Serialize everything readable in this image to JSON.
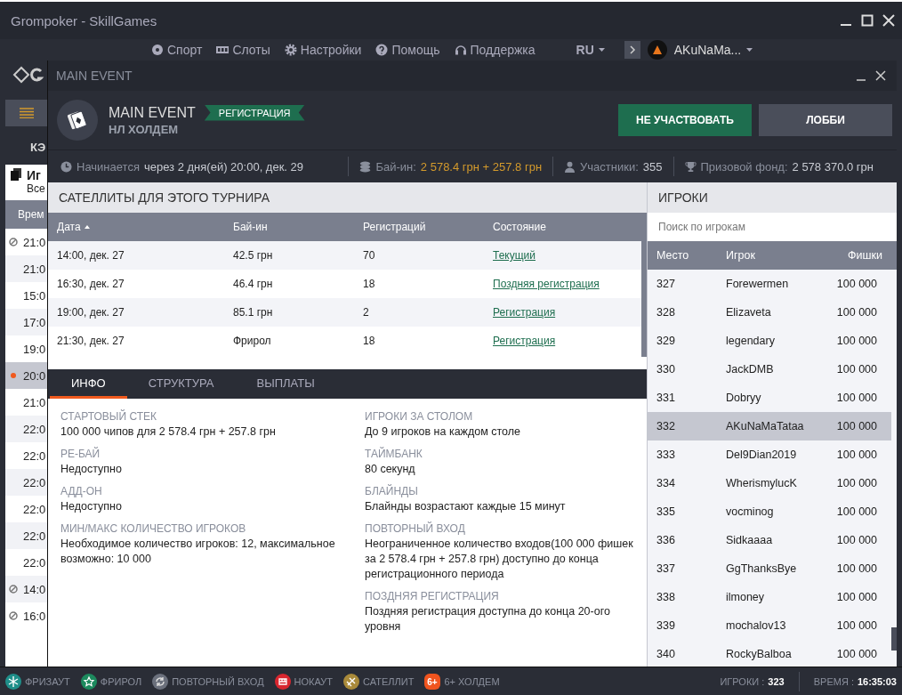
{
  "window": {
    "title": "Grompoker - SkillGames"
  },
  "nav": {
    "items": [
      {
        "label": "Спорт",
        "kind": "ball"
      },
      {
        "label": "Слоты",
        "kind": "slots"
      },
      {
        "label": "Настройки",
        "kind": "gear"
      },
      {
        "label": "Помощь",
        "kind": "help"
      },
      {
        "label": "Поддержка",
        "kind": "headset"
      }
    ],
    "language": "RU",
    "user": "AKuNaMa..."
  },
  "background_list": {
    "heading": "КЭ",
    "title": "Иг",
    "subtitle": "Все",
    "column": "Врем",
    "rows": [
      {
        "time": "21:0",
        "kind": "blocked",
        "selected": false
      },
      {
        "time": "21:0",
        "kind": "plain",
        "selected": false
      },
      {
        "time": "15:0",
        "kind": "plain",
        "selected": false
      },
      {
        "time": "17:0",
        "kind": "plain",
        "selected": false
      },
      {
        "time": "19:0",
        "kind": "plain",
        "selected": false
      },
      {
        "time": "20:0",
        "kind": "live",
        "selected": true
      },
      {
        "time": "21:0",
        "kind": "plain",
        "selected": false
      },
      {
        "time": "22:0",
        "kind": "plain",
        "selected": false
      },
      {
        "time": "22:0",
        "kind": "plain",
        "selected": false
      },
      {
        "time": "22:0",
        "kind": "plain",
        "selected": false
      },
      {
        "time": "22:0",
        "kind": "plain",
        "selected": false
      },
      {
        "time": "22:0",
        "kind": "plain",
        "selected": false
      },
      {
        "time": "22:0",
        "kind": "plain",
        "selected": false
      },
      {
        "time": "14:0",
        "kind": "blocked",
        "selected": false
      },
      {
        "time": "16:0",
        "kind": "blocked",
        "selected": false
      }
    ]
  },
  "dialog": {
    "title": "MAIN EVENT",
    "name": "MAIN EVENT",
    "game": "НЛ ХОЛДЕМ",
    "status": "РЕГИСТРАЦИЯ",
    "buttons": [
      {
        "label": "НЕ УЧАСТВОВАТЬ",
        "kind": "primary"
      },
      {
        "label": "ЛОББИ",
        "kind": "secondary"
      }
    ],
    "info_bar": [
      {
        "label": "Начинается",
        "value": "через 2 дня(ей) 20:00, дек. 29",
        "kind": "plain"
      },
      {
        "label": "Бай-ин:",
        "value": "2 578.4 грн + 257.8 грн",
        "kind": "accent"
      },
      {
        "label": "Участники:",
        "value": "355",
        "kind": "plain"
      },
      {
        "label": "Призовой фонд:",
        "value": "2 578 370.0 грн",
        "kind": "plain"
      }
    ]
  },
  "satellites": {
    "title": "САТЕЛЛИТЫ ДЛЯ ЭТОГО ТУРНИРА",
    "columns": [
      "Дата",
      "Бай-ин",
      "Регистраций",
      "Состояние"
    ],
    "rows": [
      [
        "14:00, дек. 27",
        "42.5 грн",
        "70",
        "Текущий"
      ],
      [
        "16:30, дек. 27",
        "46.4 грн",
        "18",
        "Поздняя регистрация"
      ],
      [
        "19:00, дек. 27",
        "85.1 грн",
        "2",
        "Регистрация"
      ],
      [
        "21:30, дек. 27",
        "Фрирол",
        "18",
        "Регистрация"
      ]
    ]
  },
  "tabs": [
    {
      "label": "ИНФО",
      "selected": true
    },
    {
      "label": "СТРУКТУРА",
      "selected": false
    },
    {
      "label": "ВЫПЛАТЫ",
      "selected": false
    }
  ],
  "info": {
    "left": [
      {
        "label": "СТАРТОВЫЙ СТЕК",
        "value": "100 000 чипов для 2 578.4 грн + 257.8 грн"
      },
      {
        "label": "РЕ-БАЙ",
        "value": "Недоступно"
      },
      {
        "label": "АДД-ОН",
        "value": "Недоступно"
      },
      {
        "label": "МИН/МАКС КОЛИЧЕСТВО ИГРОКОВ",
        "value": "Необходимое количество игроков: 12, максимальное возможно: 10 000"
      }
    ],
    "right": [
      {
        "label": "ИГРОКИ ЗА СТОЛОМ",
        "value": "До 9 игроков на каждом столе"
      },
      {
        "label": "ТАЙМБАНК",
        "value": "80 секунд"
      },
      {
        "label": "БЛАЙНДЫ",
        "value": "Блайнды возрастают каждые 15 минут"
      },
      {
        "label": "ПОВТОРНЫЙ ВХОД",
        "value": "Неограниченное количество входов(100 000 фишек за 2 578.4 грн + 257.8 грн) доступно до конца регистрационного периода"
      },
      {
        "label": "ПОЗДНЯЯ РЕГИСТРАЦИЯ",
        "value": "Поздняя регистрация доступна до конца 20-ого уровня"
      }
    ]
  },
  "players": {
    "title": "ИГРОКИ",
    "search": {
      "placeholder": "Поиск по игрокам"
    },
    "columns": [
      "Место",
      "Игрок",
      "Фишки"
    ],
    "rows": [
      {
        "place": "327",
        "name": "Forewermen",
        "chips": "100 000",
        "selected": false
      },
      {
        "place": "328",
        "name": "Elizaveta",
        "chips": "100 000",
        "selected": false
      },
      {
        "place": "329",
        "name": "legendary",
        "chips": "100 000",
        "selected": false
      },
      {
        "place": "330",
        "name": "JackDMB",
        "chips": "100 000",
        "selected": false
      },
      {
        "place": "331",
        "name": "Dobryy",
        "chips": "100 000",
        "selected": false
      },
      {
        "place": "332",
        "name": "AKuNaMaTataa",
        "chips": "100 000",
        "selected": true
      },
      {
        "place": "333",
        "name": "Del9Dian2019",
        "chips": "100 000",
        "selected": false
      },
      {
        "place": "334",
        "name": "WherismylucK",
        "chips": "100 000",
        "selected": false
      },
      {
        "place": "335",
        "name": "vocminog",
        "chips": "100 000",
        "selected": false
      },
      {
        "place": "336",
        "name": "Sidkaaaa",
        "chips": "100 000",
        "selected": false
      },
      {
        "place": "337",
        "name": "GgThanksBye",
        "chips": "100 000",
        "selected": false
      },
      {
        "place": "338",
        "name": "ilmoney",
        "chips": "100 000",
        "selected": false
      },
      {
        "place": "339",
        "name": "mochalov13",
        "chips": "100 000",
        "selected": false
      },
      {
        "place": "340",
        "name": "RockyBalboa",
        "chips": "100 000",
        "selected": false
      }
    ]
  },
  "status_bar": {
    "legend": [
      {
        "label": "ФРИЗАУТ",
        "kind": "snowflake",
        "color": "#1f8f8a"
      },
      {
        "label": "ФРИРОЛ",
        "kind": "star",
        "color": "#1d8a5e"
      },
      {
        "label": "ПОВТОРНЫЙ ВХОД",
        "kind": "repeat",
        "color": "#6b707c"
      },
      {
        "label": "НОКАУТ",
        "kind": "fist",
        "color": "#d8262f"
      },
      {
        "label": "САТЕЛЛИТ",
        "kind": "satellite",
        "color": "#a98a3a"
      },
      {
        "label": "6+ ХОЛДЕМ",
        "kind": "badge",
        "badge": "6+",
        "color": "#f0541e"
      }
    ],
    "players_label": "ИГРОКИ :",
    "players": "323",
    "time_label": "ВРЕМЯ :",
    "time": "16:35:03"
  }
}
